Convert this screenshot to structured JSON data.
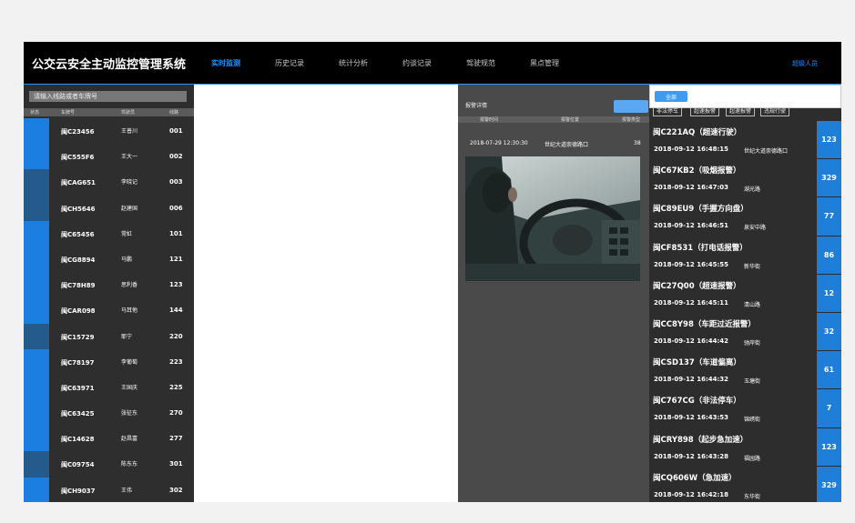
{
  "header": {
    "title": "公交云安全主动监控管理系统",
    "nav": [
      "实时监测",
      "历史记录",
      "统计分析",
      "约谈记录",
      "驾驶规范",
      "黑点管理"
    ],
    "active_index": 0,
    "user": "超级人员"
  },
  "left": {
    "search_placeholder": "请输入线路或者车牌号",
    "columns": [
      "状态",
      "车牌号",
      "驾驶员",
      "线路"
    ],
    "vehicles": [
      {
        "plate": "闽C23456",
        "driver": "王普川",
        "route": "001",
        "status_color": "#1a7fe0"
      },
      {
        "plate": "闽C555F6",
        "driver": "王大一",
        "route": "002",
        "status_color": "#1a7fe0"
      },
      {
        "plate": "闽CAG651",
        "driver": "李晓记",
        "route": "003",
        "status_color": "#245a8c"
      },
      {
        "plate": "闽CH5646",
        "driver": "赵建国",
        "route": "006",
        "status_color": "#245a8c"
      },
      {
        "plate": "闽C65456",
        "driver": "常虹",
        "route": "101",
        "status_color": "#1a7fe0"
      },
      {
        "plate": "闽CG8894",
        "driver": "马鹏",
        "route": "121",
        "status_color": "#1a7fe0"
      },
      {
        "plate": "闽C78H89",
        "driver": "思利香",
        "route": "123",
        "status_color": "#1a7fe0"
      },
      {
        "plate": "闽CAR098",
        "driver": "马耳他",
        "route": "144",
        "status_color": "#1a7fe0"
      },
      {
        "plate": "闽C15729",
        "driver": "耶宁",
        "route": "220",
        "status_color": "#245a8c"
      },
      {
        "plate": "闽C78197",
        "driver": "李葡萄",
        "route": "223",
        "status_color": "#1a7fe0"
      },
      {
        "plate": "闽C63971",
        "driver": "王国庆",
        "route": "225",
        "status_color": "#1a7fe0"
      },
      {
        "plate": "闽C63425",
        "driver": "张征东",
        "route": "270",
        "status_color": "#1a7fe0"
      },
      {
        "plate": "闽C14628",
        "driver": "赵昌富",
        "route": "277",
        "status_color": "#1a7fe0"
      },
      {
        "plate": "闽C09754",
        "driver": "陈东东",
        "route": "301",
        "status_color": "#245a8c"
      },
      {
        "plate": "闽CH9037",
        "driver": "王伟",
        "route": "302",
        "status_color": "#1a7fe0"
      }
    ]
  },
  "detail": {
    "title": "报警详情",
    "columns": [
      "报警时间",
      "报警位置",
      "报警类型"
    ],
    "time": "2018-07-29 12:30:30",
    "location": "世纪大道崇德路口",
    "code": "38"
  },
  "right": {
    "all_label": "全部",
    "chips": [
      "非法停车",
      "超速报警",
      "超速报警",
      "违规行驶"
    ],
    "alarms": [
      {
        "name": "闽C221AQ（超速行驶）",
        "time": "2018-09-12 16:48:15",
        "location": "世纪大道崇德路口",
        "count": "123"
      },
      {
        "name": "闽C67KB2（吸烟报警）",
        "time": "2018-09-12 16:47:03",
        "location": "湖光路",
        "count": "329"
      },
      {
        "name": "闽C89EU9（手握方向盘）",
        "time": "2018-09-12 16:46:51",
        "location": "泉安中路",
        "count": "77"
      },
      {
        "name": "闽CF8531（打电话报警）",
        "time": "2018-09-12 16:45:55",
        "location": "新华街",
        "count": "86"
      },
      {
        "name": "闽C27Q00（超速报警）",
        "time": "2018-09-12 16:45:11",
        "location": "清山路",
        "count": "12"
      },
      {
        "name": "闽CC8Y98（车距过近报警）",
        "time": "2018-09-12 16:44:42",
        "location": "驰岸街",
        "count": "32"
      },
      {
        "name": "闽CSD137（车道偏离）",
        "time": "2018-09-12 16:44:32",
        "location": "玉塘街",
        "count": "61"
      },
      {
        "name": "闽C767CG（非法停车）",
        "time": "2018-09-12 16:43:53",
        "location": "锦绣街",
        "count": "7"
      },
      {
        "name": "闽CRY898（起步急加速）",
        "time": "2018-09-12 16:43:28",
        "location": "福园路",
        "count": "123"
      },
      {
        "name": "闽CQ606W（急加速）",
        "time": "2018-09-12 16:42:18",
        "location": "东华街",
        "count": "329"
      }
    ]
  },
  "colors": {
    "accent": "#1e90ff",
    "count_bg": "#1f7fd8",
    "panel_dark": "#2e2e2e",
    "panel_mid": "#4a4a4a"
  }
}
